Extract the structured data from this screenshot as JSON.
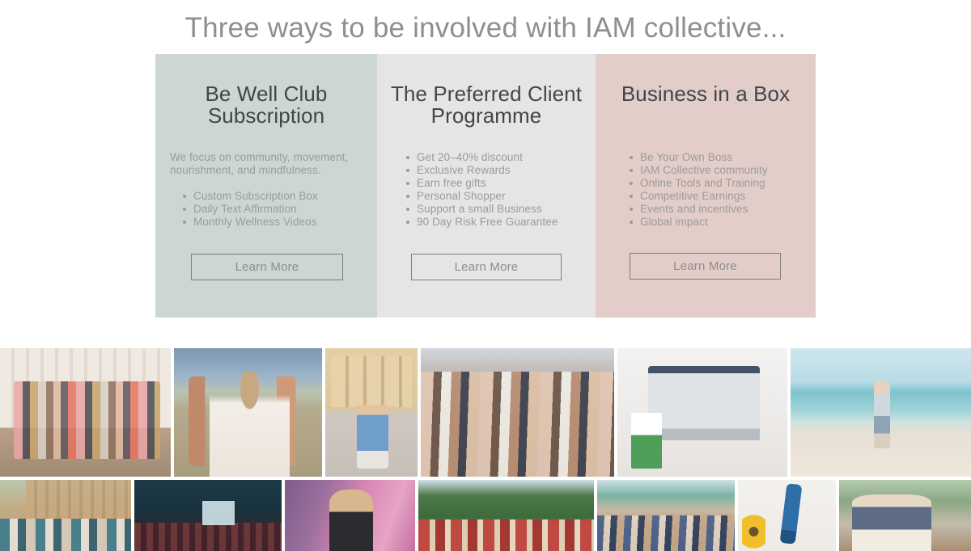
{
  "heading": "Three ways to be involved with IAM collective...",
  "panels": [
    {
      "title": "Be Well Club Subscription",
      "bg": "#ccd6d2",
      "intro": "We focus on community, movement, nourishment, and mindfulness.",
      "items": [
        "Custom Subscription Box",
        "Daily Text Affirmation",
        "Monthly Wellness Videos"
      ],
      "cta": "Learn More"
    },
    {
      "title": "The Preferred Client Programme",
      "bg": "#e7e4e5",
      "intro": "",
      "items": [
        "Get 20–40% discount",
        "Exclusive Rewards",
        "Earn free gifts",
        "Personal Shopper",
        "Support a small Business",
        "90 Day Risk Free Guarantee"
      ],
      "cta": "Learn More"
    },
    {
      "title": "Business in a Box",
      "bg": "#e2cdc8",
      "intro": "",
      "items": [
        "Be Your Own Boss",
        "IAM Collective community",
        "Online Tools and Training",
        "Competitive Earnings",
        "Events and incentives",
        "Global impact"
      ],
      "cta": "Learn More"
    }
  ],
  "gallery": {
    "rows": [
      {
        "tiles": [
          {
            "alt": "group-of-women-on-steps"
          },
          {
            "alt": "woman-with-hat-and-children-in-field"
          },
          {
            "alt": "woman-in-blue-dress-on-street"
          },
          {
            "alt": "crowd-at-outdoor-party"
          },
          {
            "alt": "laptop-desk-with-product-box"
          },
          {
            "alt": "woman-with-bag-on-beach"
          }
        ]
      },
      {
        "tiles": [
          {
            "alt": "group-outside-wooden-house"
          },
          {
            "alt": "fashion-show-stage-event"
          },
          {
            "alt": "woman-in-front-of-pink-wall"
          },
          {
            "alt": "group-of-women-in-red-by-forest"
          },
          {
            "alt": "crowd-at-outdoor-market"
          },
          {
            "alt": "sunglasses-and-skincare-flatlay"
          },
          {
            "alt": "two-women-with-drinks-on-patio"
          }
        ]
      }
    ]
  },
  "colors": {
    "heading_text": "#8f8f8f",
    "title_text": "#414649",
    "body_text": "#9b9b9b",
    "button_border": "#7d7d7d",
    "button_text": "#8d8d8d",
    "page_bg": "#ffffff"
  }
}
